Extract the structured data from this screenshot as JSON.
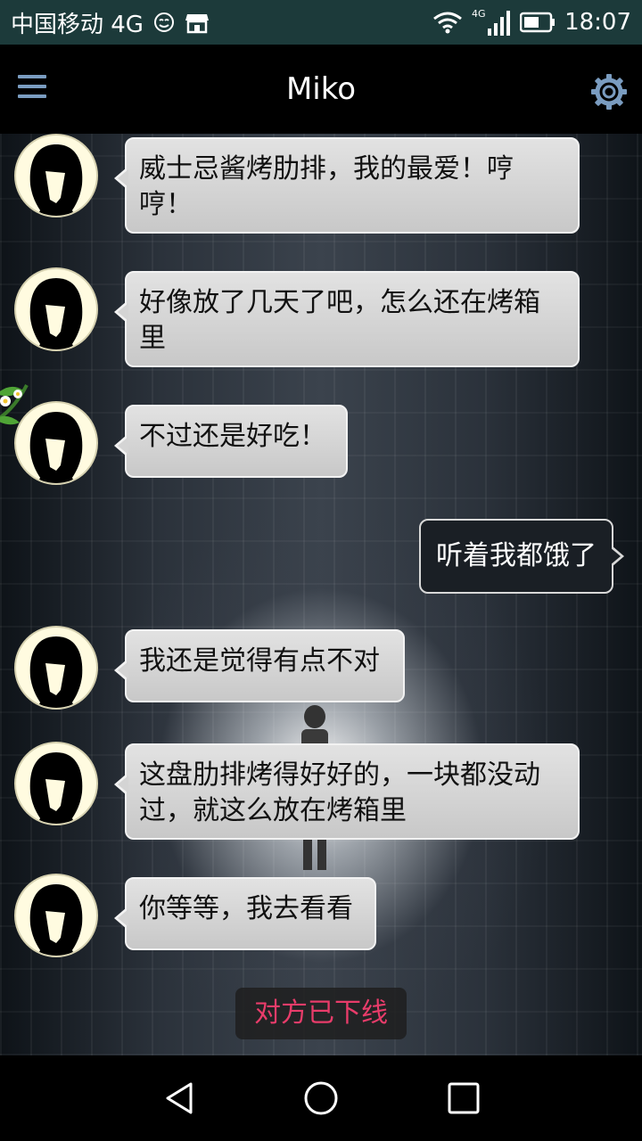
{
  "status_bar": {
    "carrier": "中国移动 4G",
    "network_label": "4G",
    "time": "18:07",
    "icons": [
      "smiley-notification-icon",
      "store-notification-icon",
      "wifi-icon",
      "cellular-signal-icon",
      "battery-icon"
    ]
  },
  "app_bar": {
    "title": "Miko",
    "left_icon": "menu-icon",
    "right_icon": "gear-icon"
  },
  "messages": [
    {
      "side": "left",
      "text": "威士忌酱烤肋排，我的最爱！哼哼！"
    },
    {
      "side": "left",
      "text": "好像放了几天了吧，怎么还在烤箱里"
    },
    {
      "side": "left",
      "text": "不过还是好吃！"
    },
    {
      "side": "right",
      "text": "听着我都饿了"
    },
    {
      "side": "left",
      "text": "我还是觉得有点不对"
    },
    {
      "side": "left",
      "text": "这盘肋排烤得好好的，一块都没动过，就这么放在烤箱里"
    },
    {
      "side": "left",
      "text": "你等等，我去看看"
    }
  ],
  "system_notice": "对方已下线",
  "colors": {
    "status_bar_bg": "#1c3a3a",
    "app_bar_bg": "#000000",
    "icon_accent": "#7a9cc0",
    "left_bubble": "#d4d4d4",
    "right_bubble": "#1a1f25",
    "notice_text": "#e83c6a"
  },
  "nav_bar": {
    "icons": [
      "back-icon",
      "home-icon",
      "recents-icon"
    ]
  }
}
